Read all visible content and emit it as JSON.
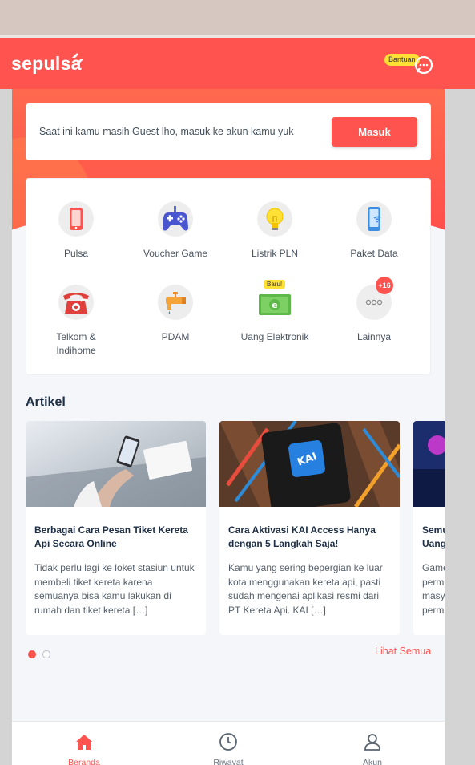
{
  "header": {
    "logo_text": "sepulsa",
    "help_label": "Bantuan"
  },
  "guest": {
    "message": "Saat ini kamu masih Guest lho, masuk ke akun kamu yuk",
    "login_label": "Masuk"
  },
  "menu": {
    "items": [
      {
        "label": "Pulsa",
        "icon": "phone-icon"
      },
      {
        "label": "Voucher Game",
        "icon": "gamepad-icon"
      },
      {
        "label": "Listrik PLN",
        "icon": "lightbulb-icon"
      },
      {
        "label": "Paket Data",
        "icon": "data-phone-icon"
      },
      {
        "label": "Telkom & Indihome",
        "icon": "telephone-icon"
      },
      {
        "label": "PDAM",
        "icon": "water-tap-icon"
      },
      {
        "label": "Uang Elektronik",
        "icon": "e-money-icon",
        "badge": "Baru!"
      },
      {
        "label": "Lainnya",
        "icon": "more-icon",
        "badge": "+16"
      }
    ]
  },
  "articles": {
    "section_title": "Artikel",
    "items": [
      {
        "title": "Berbagai Cara Pesan Tiket Kereta Api Secara Online",
        "desc": "Tidak perlu lagi ke loket stasiun untuk membeli tiket kereta karena semuanya bisa kamu lakukan di rumah dan tiket kereta […]"
      },
      {
        "title": "Cara Aktivasi KAI Access Hanya dengan 5 Langkah Saja!",
        "desc": "Kamu yang sering bepergian ke luar kota menggunakan kereta api, pasti sudah mengenai aplikasi resmi dari PT Kereta Api. KAI […]"
      },
      {
        "title": "Semu Uang",
        "desc": "Game perm masy perm"
      }
    ],
    "see_all": "Lihat Semua"
  },
  "nav": {
    "items": [
      {
        "label": "Beranda",
        "active": true
      },
      {
        "label": "Riwayat",
        "active": false
      },
      {
        "label": "Akun",
        "active": false
      }
    ]
  },
  "colors": {
    "brand": "#ff5350",
    "yellow": "#ffe136",
    "dark_text": "#1d2e45"
  }
}
